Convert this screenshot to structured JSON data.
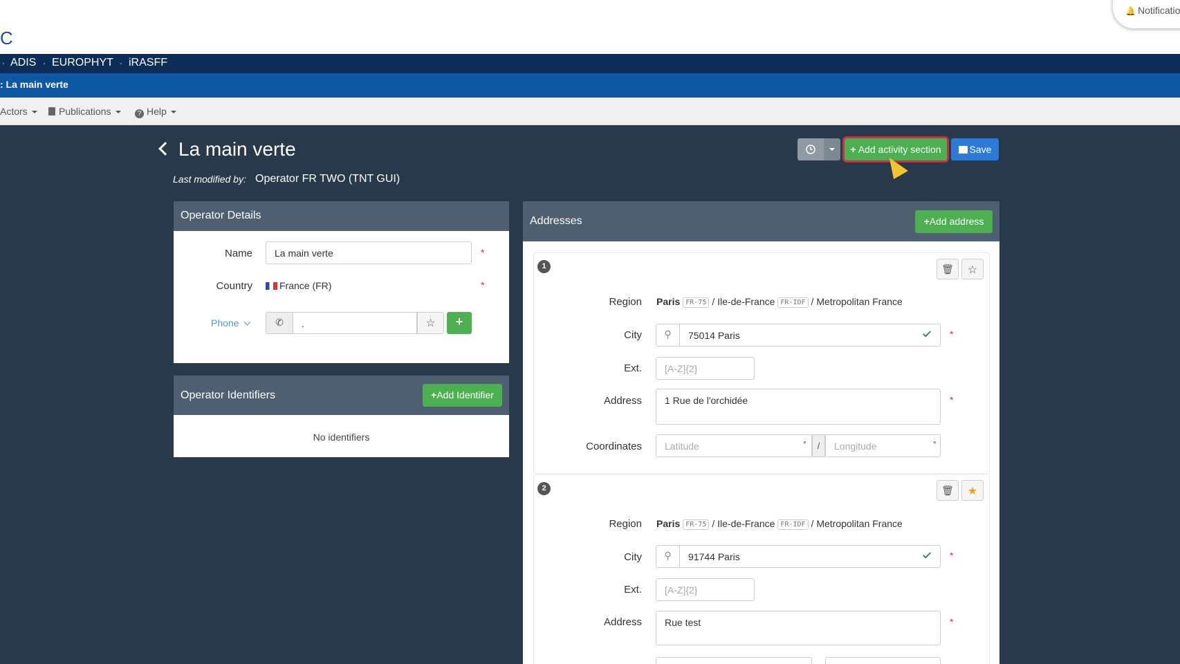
{
  "top": {
    "logo": "C",
    "notifications": "Notifications"
  },
  "nav": {
    "items": [
      "ADIS",
      "EUROPHYT",
      "iRASFF"
    ]
  },
  "context": {
    "title": ": La main verte"
  },
  "menu": {
    "actors": "Actors",
    "publications": "Publications",
    "help": "Help"
  },
  "header": {
    "title": "La main verte",
    "last_modified_label": "Last modified by:",
    "last_modified_value": "Operator FR TWO (TNT GUI)",
    "add_activity_label": "Add activity section",
    "save_label": "Save"
  },
  "operator_details": {
    "heading": "Operator Details",
    "name_label": "Name",
    "name_value": "La main verte",
    "country_label": "Country",
    "country_value": "France (FR)",
    "phone_label": "Phone",
    "phone_value": ".",
    "required": "*"
  },
  "identifiers": {
    "heading": "Operator Identifiers",
    "add_label": "Add Identifier",
    "empty_text": "No identifiers"
  },
  "addresses": {
    "heading": "Addresses",
    "add_label": "Add address",
    "items": [
      {
        "index": "1",
        "region_label": "Region",
        "region_city": "Paris",
        "region_city_code": "FR-75",
        "region_area": "Ile-de-France",
        "region_area_code": "FR-IDF",
        "region_country": "Metropolitan France",
        "city_label": "City",
        "city_value": "75014 Paris",
        "ext_label": "Ext.",
        "ext_placeholder": "[A-Z]{2}",
        "address_label": "Address",
        "address_value": "1 Rue de l'orchidée",
        "coordinates_label": "Coordinates",
        "latitude_placeholder": "Latitude",
        "longitude_placeholder": "Longitude",
        "favorite": false
      },
      {
        "index": "2",
        "region_label": "Region",
        "region_city": "Paris",
        "region_city_code": "FR-75",
        "region_area": "Ile-de-France",
        "region_area_code": "FR-IDF",
        "region_country": "Metropolitan France",
        "city_label": "City",
        "city_value": "91744 Paris",
        "ext_label": "Ext.",
        "ext_placeholder": "[A-Z]{2}",
        "address_label": "Address",
        "address_value": "Rue test",
        "favorite": true
      }
    ]
  },
  "symbols": {
    "slash": "/",
    "degree": "°"
  },
  "colors": {
    "green": "#4caf50",
    "blue": "#2e7bd6",
    "navy": "#0c2d58",
    "highlight": "#c72e47",
    "star": "#f39c12"
  }
}
